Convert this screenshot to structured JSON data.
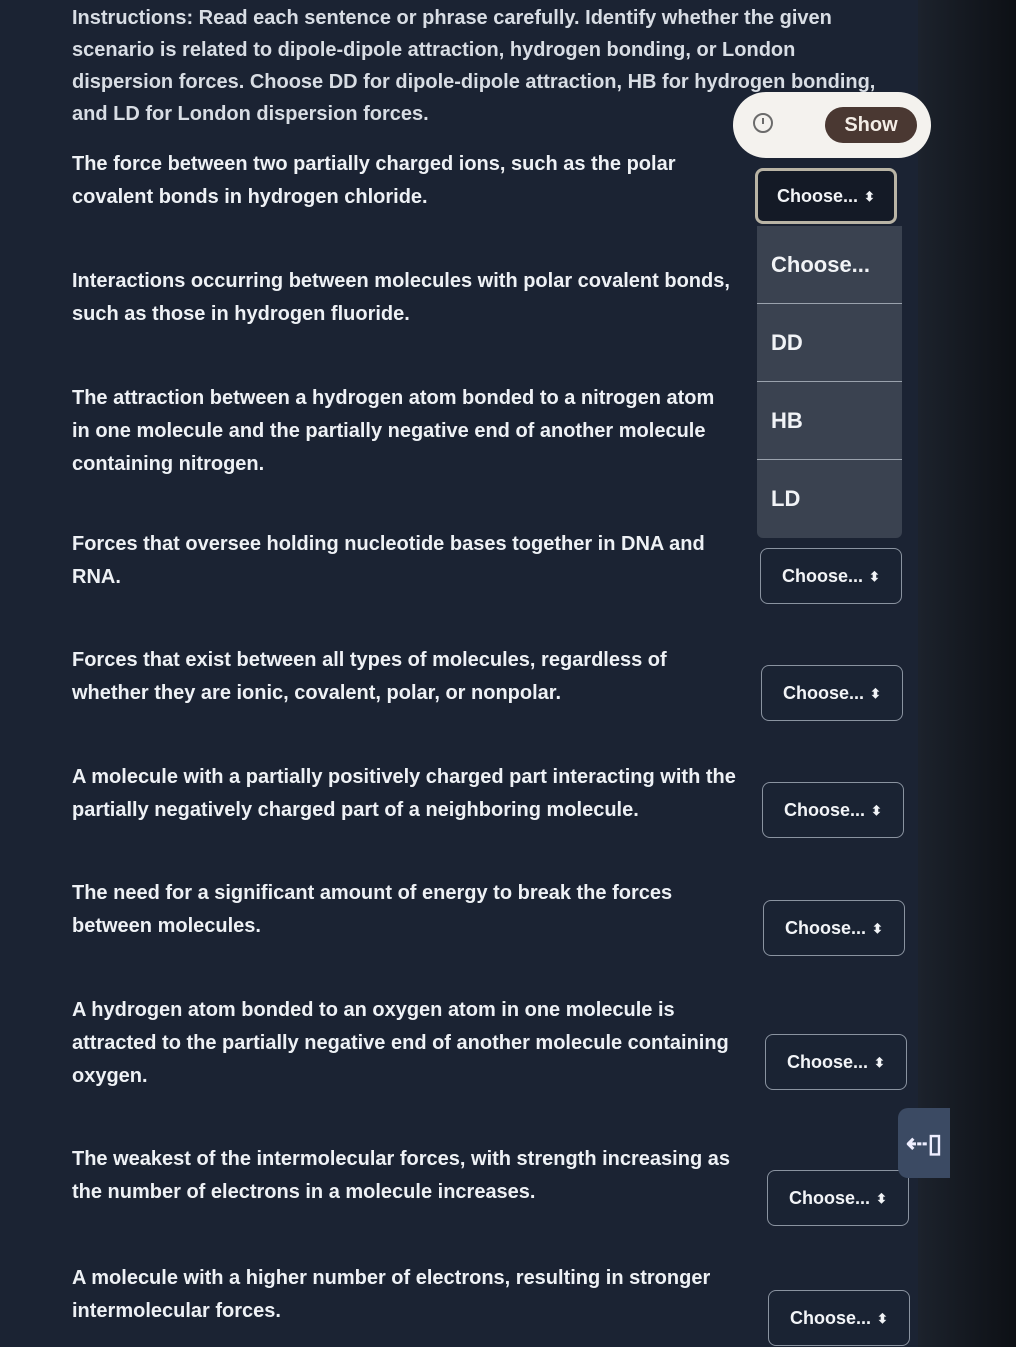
{
  "instructions": "Instructions: Read each sentence or phrase carefully. Identify whether the given scenario is related to dipole-dipole attraction, hydrogen bonding, or London dispersion forces. Choose DD for dipole-dipole attraction, HB for hydrogen bonding, and LD for London dispersion forces.",
  "timer": {
    "icon": "clock-icon",
    "show_label": "Show"
  },
  "select_placeholder": "Choose...",
  "questions": [
    {
      "text": "The force between two partially charged ions, such as the polar covalent bonds in hydrogen chloride.",
      "value": "Choose..."
    },
    {
      "text": "Interactions occurring between molecules with polar covalent bonds, such as those in hydrogen fluoride.",
      "value": ""
    },
    {
      "text": "The attraction between a hydrogen atom bonded to a nitrogen atom in one molecule and the partially negative end of another molecule containing nitrogen.",
      "value": ""
    },
    {
      "text": "Forces that oversee holding nucleotide bases together in DNA and RNA.",
      "value": "Choose..."
    },
    {
      "text": "Forces that exist between all types of molecules, regardless of whether they are ionic, covalent, polar, or nonpolar.",
      "value": "Choose..."
    },
    {
      "text": "A molecule with a partially positively charged part interacting with the partially negatively charged part of a neighboring molecule.",
      "value": "Choose..."
    },
    {
      "text": "The need for a significant amount of energy to break the forces between molecules.",
      "value": "Choose..."
    },
    {
      "text": "A hydrogen atom bonded to an oxygen atom in one molecule is attracted to the partially negative end of another molecule containing oxygen.",
      "value": "Choose..."
    },
    {
      "text": "The weakest of the intermolecular forces, with strength increasing as the number of electrons in a molecule increases.",
      "value": "Choose..."
    },
    {
      "text": "A molecule with a higher number of electrons, resulting in stronger intermolecular forces.",
      "value": "Choose..."
    }
  ],
  "dropdown_options": [
    "Choose...",
    "DD",
    "HB",
    "LD"
  ],
  "exit_icon": "exit-icon"
}
